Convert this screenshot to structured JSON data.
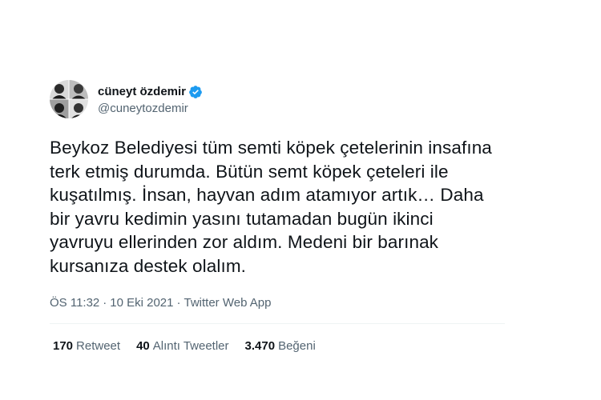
{
  "author": {
    "display_name": "cüneyt özdemir",
    "handle": "@cuneytozdemir",
    "verified_icon": "verified-badge-icon",
    "verified_color": "#1d9bf0"
  },
  "tweet": {
    "lines": [
      "Beykoz Belediyesi tüm semti köpek çetelerinin insafına",
      "terk etmiş durumda. Bütün semt köpek çeteleri ile",
      "kuşatılmış. İnsan, hayvan adım atamıyor artık… Daha",
      "bir yavru kedimin yasını tutamadan bugün ikinci",
      "yavruyu ellerinden zor aldım. Medeni bir barınak",
      "kursanıza destek olalım."
    ]
  },
  "meta": {
    "time": "ÖS 11:32",
    "separator": "·",
    "date": "10 Eki 2021",
    "source": "Twitter Web App"
  },
  "stats": {
    "retweets_count": "170",
    "retweets_label": "Retweet",
    "quotes_count": "40",
    "quotes_label": "Alıntı Tweetler",
    "likes_count": "3.470",
    "likes_label": "Beğeni"
  }
}
